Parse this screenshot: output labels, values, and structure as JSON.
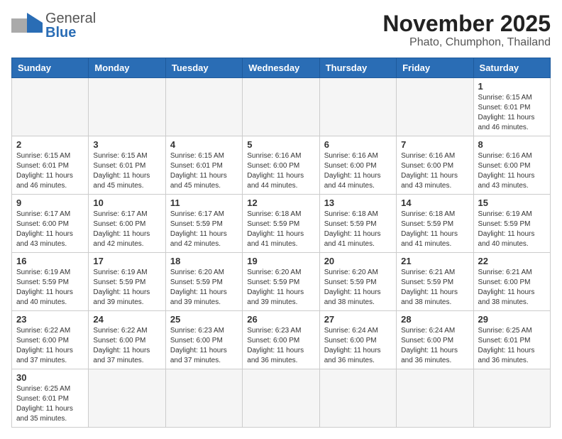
{
  "header": {
    "logo_general": "General",
    "logo_blue": "Blue",
    "month_year": "November 2025",
    "location": "Phato, Chumphon, Thailand"
  },
  "days_of_week": [
    "Sunday",
    "Monday",
    "Tuesday",
    "Wednesday",
    "Thursday",
    "Friday",
    "Saturday"
  ],
  "weeks": [
    [
      {
        "day": "",
        "empty": true
      },
      {
        "day": "",
        "empty": true
      },
      {
        "day": "",
        "empty": true
      },
      {
        "day": "",
        "empty": true
      },
      {
        "day": "",
        "empty": true
      },
      {
        "day": "",
        "empty": true
      },
      {
        "day": "1",
        "sunrise": "Sunrise: 6:15 AM",
        "sunset": "Sunset: 6:01 PM",
        "daylight": "Daylight: 11 hours and 46 minutes."
      }
    ],
    [
      {
        "day": "2",
        "sunrise": "Sunrise: 6:15 AM",
        "sunset": "Sunset: 6:01 PM",
        "daylight": "Daylight: 11 hours and 46 minutes."
      },
      {
        "day": "3",
        "sunrise": "Sunrise: 6:15 AM",
        "sunset": "Sunset: 6:01 PM",
        "daylight": "Daylight: 11 hours and 45 minutes."
      },
      {
        "day": "4",
        "sunrise": "Sunrise: 6:15 AM",
        "sunset": "Sunset: 6:01 PM",
        "daylight": "Daylight: 11 hours and 45 minutes."
      },
      {
        "day": "5",
        "sunrise": "Sunrise: 6:16 AM",
        "sunset": "Sunset: 6:00 PM",
        "daylight": "Daylight: 11 hours and 44 minutes."
      },
      {
        "day": "6",
        "sunrise": "Sunrise: 6:16 AM",
        "sunset": "Sunset: 6:00 PM",
        "daylight": "Daylight: 11 hours and 44 minutes."
      },
      {
        "day": "7",
        "sunrise": "Sunrise: 6:16 AM",
        "sunset": "Sunset: 6:00 PM",
        "daylight": "Daylight: 11 hours and 43 minutes."
      },
      {
        "day": "8",
        "sunrise": "Sunrise: 6:16 AM",
        "sunset": "Sunset: 6:00 PM",
        "daylight": "Daylight: 11 hours and 43 minutes."
      }
    ],
    [
      {
        "day": "9",
        "sunrise": "Sunrise: 6:17 AM",
        "sunset": "Sunset: 6:00 PM",
        "daylight": "Daylight: 11 hours and 43 minutes."
      },
      {
        "day": "10",
        "sunrise": "Sunrise: 6:17 AM",
        "sunset": "Sunset: 6:00 PM",
        "daylight": "Daylight: 11 hours and 42 minutes."
      },
      {
        "day": "11",
        "sunrise": "Sunrise: 6:17 AM",
        "sunset": "Sunset: 5:59 PM",
        "daylight": "Daylight: 11 hours and 42 minutes."
      },
      {
        "day": "12",
        "sunrise": "Sunrise: 6:18 AM",
        "sunset": "Sunset: 5:59 PM",
        "daylight": "Daylight: 11 hours and 41 minutes."
      },
      {
        "day": "13",
        "sunrise": "Sunrise: 6:18 AM",
        "sunset": "Sunset: 5:59 PM",
        "daylight": "Daylight: 11 hours and 41 minutes."
      },
      {
        "day": "14",
        "sunrise": "Sunrise: 6:18 AM",
        "sunset": "Sunset: 5:59 PM",
        "daylight": "Daylight: 11 hours and 41 minutes."
      },
      {
        "day": "15",
        "sunrise": "Sunrise: 6:19 AM",
        "sunset": "Sunset: 5:59 PM",
        "daylight": "Daylight: 11 hours and 40 minutes."
      }
    ],
    [
      {
        "day": "16",
        "sunrise": "Sunrise: 6:19 AM",
        "sunset": "Sunset: 5:59 PM",
        "daylight": "Daylight: 11 hours and 40 minutes."
      },
      {
        "day": "17",
        "sunrise": "Sunrise: 6:19 AM",
        "sunset": "Sunset: 5:59 PM",
        "daylight": "Daylight: 11 hours and 39 minutes."
      },
      {
        "day": "18",
        "sunrise": "Sunrise: 6:20 AM",
        "sunset": "Sunset: 5:59 PM",
        "daylight": "Daylight: 11 hours and 39 minutes."
      },
      {
        "day": "19",
        "sunrise": "Sunrise: 6:20 AM",
        "sunset": "Sunset: 5:59 PM",
        "daylight": "Daylight: 11 hours and 39 minutes."
      },
      {
        "day": "20",
        "sunrise": "Sunrise: 6:20 AM",
        "sunset": "Sunset: 5:59 PM",
        "daylight": "Daylight: 11 hours and 38 minutes."
      },
      {
        "day": "21",
        "sunrise": "Sunrise: 6:21 AM",
        "sunset": "Sunset: 5:59 PM",
        "daylight": "Daylight: 11 hours and 38 minutes."
      },
      {
        "day": "22",
        "sunrise": "Sunrise: 6:21 AM",
        "sunset": "Sunset: 6:00 PM",
        "daylight": "Daylight: 11 hours and 38 minutes."
      }
    ],
    [
      {
        "day": "23",
        "sunrise": "Sunrise: 6:22 AM",
        "sunset": "Sunset: 6:00 PM",
        "daylight": "Daylight: 11 hours and 37 minutes."
      },
      {
        "day": "24",
        "sunrise": "Sunrise: 6:22 AM",
        "sunset": "Sunset: 6:00 PM",
        "daylight": "Daylight: 11 hours and 37 minutes."
      },
      {
        "day": "25",
        "sunrise": "Sunrise: 6:23 AM",
        "sunset": "Sunset: 6:00 PM",
        "daylight": "Daylight: 11 hours and 37 minutes."
      },
      {
        "day": "26",
        "sunrise": "Sunrise: 6:23 AM",
        "sunset": "Sunset: 6:00 PM",
        "daylight": "Daylight: 11 hours and 36 minutes."
      },
      {
        "day": "27",
        "sunrise": "Sunrise: 6:24 AM",
        "sunset": "Sunset: 6:00 PM",
        "daylight": "Daylight: 11 hours and 36 minutes."
      },
      {
        "day": "28",
        "sunrise": "Sunrise: 6:24 AM",
        "sunset": "Sunset: 6:00 PM",
        "daylight": "Daylight: 11 hours and 36 minutes."
      },
      {
        "day": "29",
        "sunrise": "Sunrise: 6:25 AM",
        "sunset": "Sunset: 6:01 PM",
        "daylight": "Daylight: 11 hours and 36 minutes."
      }
    ],
    [
      {
        "day": "30",
        "sunrise": "Sunrise: 6:25 AM",
        "sunset": "Sunset: 6:01 PM",
        "daylight": "Daylight: 11 hours and 35 minutes."
      },
      {
        "day": "",
        "empty": true
      },
      {
        "day": "",
        "empty": true
      },
      {
        "day": "",
        "empty": true
      },
      {
        "day": "",
        "empty": true
      },
      {
        "day": "",
        "empty": true
      },
      {
        "day": "",
        "empty": true
      }
    ]
  ]
}
